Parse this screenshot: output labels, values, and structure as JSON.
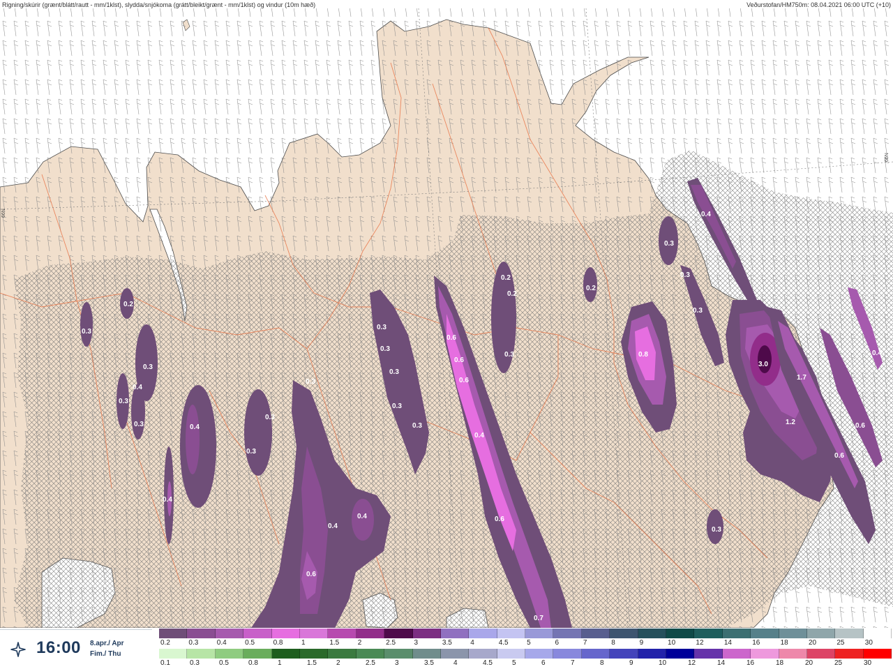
{
  "header": {
    "left_title": "Rigning/skúrir (grænt/blátt/rautt - mm/1klst), slydda/snjókoma (grátt/bleikt/grænt - mm/1klst) og vindur (10m hæð)",
    "right_title": "Veðurstofan/HM750m: 08.04.2021 06:00 UTC (+10)"
  },
  "grid_labels": {
    "left": "66N",
    "right": "66N"
  },
  "time_panel": {
    "icon": "compass-star-icon",
    "time": "16:00",
    "date_line1": "8.apr./ Apr",
    "date_line2": "Fim./ Thu"
  },
  "legends": {
    "snow": {
      "labels": [
        "0.2",
        "0.3",
        "0.4",
        "0.5",
        "0.8",
        "1",
        "1.5",
        "2",
        "2.5",
        "3",
        "3.5",
        "4",
        "4.5",
        "5",
        "6",
        "7",
        "8",
        "9",
        "10",
        "12",
        "14",
        "16",
        "18",
        "20",
        "25",
        "30"
      ],
      "colors": [
        "#6f4e78",
        "#8a4e92",
        "#a65aae",
        "#c860c9",
        "#e66ee0",
        "#d977d9",
        "#b74aaf",
        "#922d8a",
        "#4e0a4a",
        "#7c2e82",
        "#9070c0",
        "#a9a7ea",
        "#c4c4f2",
        "#9999d8",
        "#7575b3",
        "#585e8f",
        "#3e5570",
        "#25505c",
        "#0f4a48",
        "#1e5e5d",
        "#3c6f72",
        "#56808a",
        "#6f9099",
        "#8fa6aa",
        "#b6c3c5",
        "#ffffff"
      ]
    },
    "rain": {
      "labels": [
        "0.1",
        "0.3",
        "0.5",
        "0.8",
        "1",
        "1.5",
        "2",
        "2.5",
        "3",
        "3.5",
        "4",
        "4.5",
        "5",
        "6",
        "7",
        "8",
        "9",
        "10",
        "12",
        "14",
        "16",
        "18",
        "20",
        "25",
        "30"
      ],
      "colors": [
        "#d9f7d0",
        "#b7e5a6",
        "#8fcc80",
        "#6aad5c",
        "#1e5e1e",
        "#2a6a2a",
        "#3a7a3f",
        "#4a8a55",
        "#5a8e6c",
        "#708d8c",
        "#8b95ab",
        "#a7a8cb",
        "#c9caf0",
        "#a6a8ea",
        "#8888dd",
        "#6666cc",
        "#4444bb",
        "#2222aa",
        "#000099",
        "#6633aa",
        "#cc66cc",
        "#ee99dd",
        "#ee88aa",
        "#dd4466",
        "#ee2222",
        "#ff0000"
      ]
    }
  },
  "precip_labels": [
    {
      "text": "0.4"
    },
    {
      "text": "0.3"
    },
    {
      "text": "0.3"
    },
    {
      "text": "0.2"
    },
    {
      "text": "0.2"
    },
    {
      "text": "0.2"
    },
    {
      "text": "0.3"
    },
    {
      "text": "0.8"
    },
    {
      "text": "0.3"
    },
    {
      "text": "0.2"
    },
    {
      "text": "0.3"
    },
    {
      "text": "0.3"
    },
    {
      "text": "0.4"
    },
    {
      "text": "0.3"
    },
    {
      "text": "0.3"
    },
    {
      "text": "0.3"
    },
    {
      "text": "0.6"
    },
    {
      "text": "0.6"
    },
    {
      "text": "0.6"
    },
    {
      "text": "0.3"
    },
    {
      "text": "0.3"
    },
    {
      "text": "3.0"
    },
    {
      "text": "1.7"
    },
    {
      "text": "1.2"
    },
    {
      "text": "0.6"
    },
    {
      "text": "0.6"
    },
    {
      "text": "0.3"
    },
    {
      "text": "0.3"
    },
    {
      "text": "0.4"
    },
    {
      "text": "0.4"
    },
    {
      "text": "0.3"
    },
    {
      "text": "0.4"
    },
    {
      "text": "0.4"
    },
    {
      "text": "0.6"
    },
    {
      "text": "0.6"
    },
    {
      "text": "0.7"
    },
    {
      "text": "0.3"
    },
    {
      "text": "0.4"
    },
    {
      "text": "0.3"
    },
    {
      "text": "0.4"
    },
    {
      "text": "0.3"
    }
  ]
}
